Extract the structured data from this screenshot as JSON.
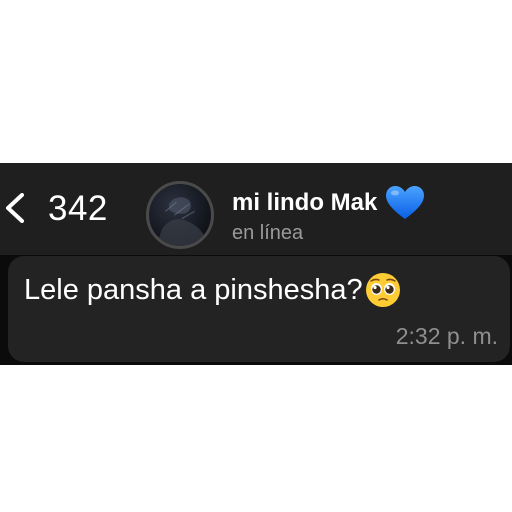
{
  "header": {
    "back_icon": "chevron-left-icon",
    "back_count": "342",
    "contact_name": "mi lindo Mak",
    "contact_status": "en línea",
    "avatar_icon": "contact-avatar-photo",
    "name_emoji_icon": "blue-heart-icon"
  },
  "message": {
    "text": "Lele pansha a pinshesha?",
    "emoji_icon": "pleading-face-icon",
    "time": "2:32 p. m."
  },
  "colors": {
    "header_bg": "#1f1f1f",
    "bubble_bg": "#232323",
    "text": "#ffffff",
    "muted": "#9a9a9a",
    "heart": "#1e78ff"
  }
}
